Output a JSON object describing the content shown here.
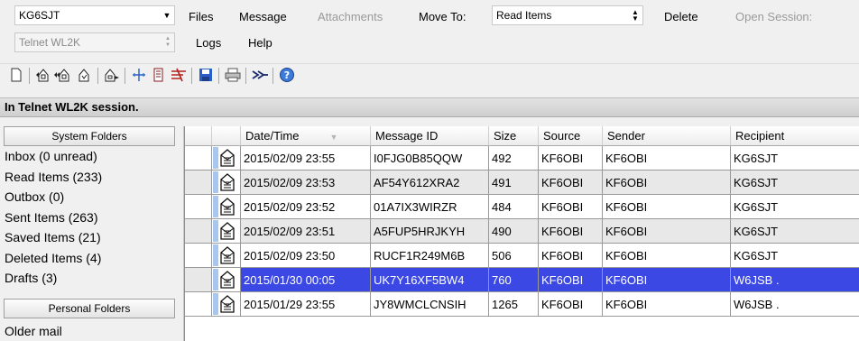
{
  "top": {
    "callsign": "KG6SJT",
    "session_type": "Telnet WL2K",
    "menu": {
      "files": "Files",
      "message": "Message",
      "attachments": "Attachments",
      "move_to": "Move To:",
      "move_target": "Read Items",
      "delete": "Delete",
      "open_session": "Open Session:",
      "logs": "Logs",
      "help": "Help"
    }
  },
  "session_status": "In Telnet WL2K session.",
  "folders": {
    "system_header": "System Folders",
    "system": [
      "Inbox (0 unread)",
      "Read Items  (233)",
      "Outbox  (0)",
      "Sent Items  (263)",
      "Saved Items  (21)",
      "Deleted Items  (4)",
      "Drafts  (3)"
    ],
    "personal_header": "Personal Folders",
    "personal": [
      "Older mail"
    ]
  },
  "grid": {
    "columns": [
      "Date/Time",
      "Message ID",
      "Size",
      "Source",
      "Sender",
      "Recipient"
    ],
    "rows": [
      [
        "2015/02/09 23:55",
        "I0FJG0B85QQW",
        "492",
        "KF6OBI",
        "KF6OBI",
        "KG6SJT"
      ],
      [
        "2015/02/09 23:53",
        "AF54Y612XRA2",
        "491",
        "KF6OBI",
        "KF6OBI",
        "KG6SJT"
      ],
      [
        "2015/02/09 23:52",
        "01A7IX3WIRZR",
        "484",
        "KF6OBI",
        "KF6OBI",
        "KG6SJT"
      ],
      [
        "2015/02/09 23:51",
        "A5FUP5HRJKYH",
        "490",
        "KF6OBI",
        "KF6OBI",
        "KG6SJT"
      ],
      [
        "2015/02/09 23:50",
        "RUCF1R249M6B",
        "506",
        "KF6OBI",
        "KF6OBI",
        "KG6SJT"
      ],
      [
        "2015/01/30 00:05",
        "UK7Y16XF5BW4",
        "760",
        "KF6OBI",
        "KF6OBI",
        "W6JSB ."
      ],
      [
        "2015/01/29 23:55",
        "JY8WMCLCNSIH",
        "1265",
        "KF6OBI",
        "KF6OBI",
        "W6JSB ."
      ]
    ],
    "selected_row": 5
  },
  "colors": {
    "selection": "#3b48e3",
    "alt_row": "#e8e8e8"
  }
}
